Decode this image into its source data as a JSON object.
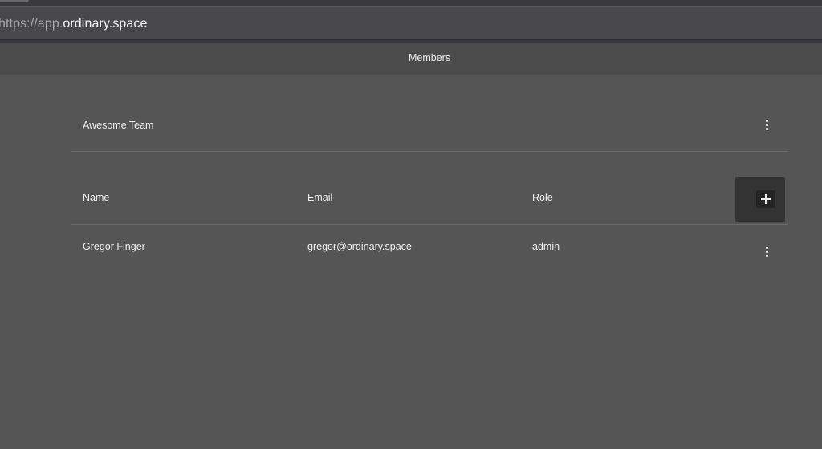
{
  "browser": {
    "url_scheme": "https://",
    "url_subdomain": "app.",
    "url_domain": "ordinary.space"
  },
  "header": {
    "title": "Members"
  },
  "team": {
    "name": "Awesome Team"
  },
  "table": {
    "columns": [
      "Name",
      "Email",
      "Role"
    ],
    "rows": [
      {
        "name": "Gregor Finger",
        "email": "gregor@ordinary.space",
        "role": "admin"
      }
    ]
  },
  "icons": {
    "team_menu": "more-vert-icon",
    "add_member": "plus-icon",
    "row_menu": "more-vert-icon"
  },
  "colors": {
    "page_background": "#555555",
    "header_background": "#4b4b4b",
    "add_button_background": "#333333"
  }
}
